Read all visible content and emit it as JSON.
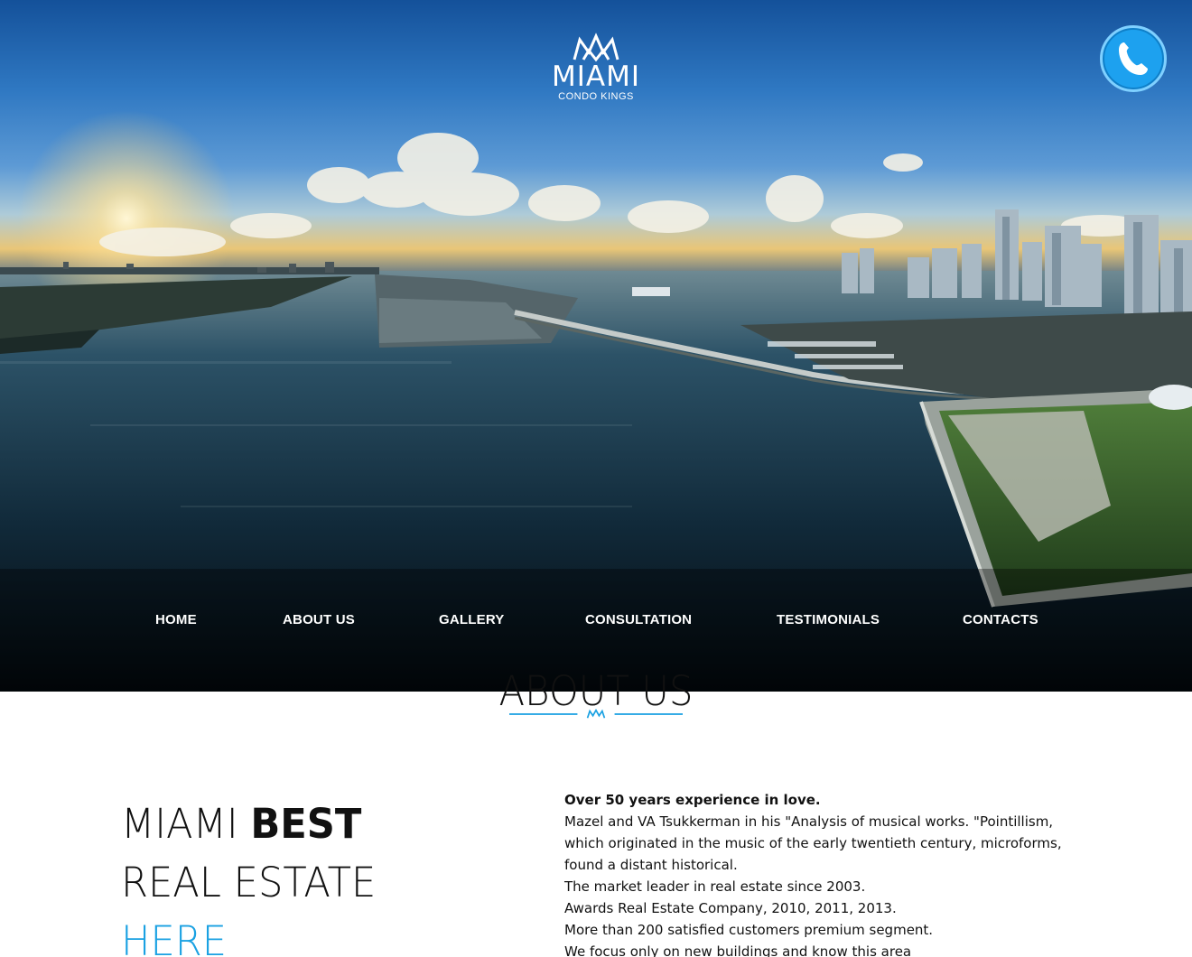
{
  "logo": {
    "brand": "MIAMI",
    "tagline": "CONDO KINGS",
    "icon": "crown-icon"
  },
  "phone_button": {
    "icon": "phone-icon"
  },
  "nav": {
    "items": [
      {
        "label": "HOME"
      },
      {
        "label": "ABOUT US"
      },
      {
        "label": "GALLERY"
      },
      {
        "label": "CONSULTATION"
      },
      {
        "label": "TESTIMONIALS"
      },
      {
        "label": "CONTACTS"
      }
    ]
  },
  "about": {
    "title": "ABOUT US",
    "divider_icon": "crown-mini-icon",
    "headline": {
      "line1_light": "MIAMI ",
      "line1_bold": "BEST",
      "line2": "REAL ESTATE",
      "line3": "HERE"
    },
    "lead": "Over 50 years experience in love.",
    "lines": [
      "Mazel and VA Tsukkerman in his \"Analysis of musical works. \"Pointillism, which originated in the music of the early twentieth century, microforms, found a distant historical.",
      "The market leader in real estate since 2003.",
      "Awards Real Estate Company, 2010, 2011, 2013.",
      "More than 200 satisfied customers premium segment.",
      "We focus only on new buildings and know this area"
    ]
  },
  "colors": {
    "accent": "#1aa1e2",
    "phone_button": "#1da1ef",
    "nav_text": "#ffffff"
  }
}
